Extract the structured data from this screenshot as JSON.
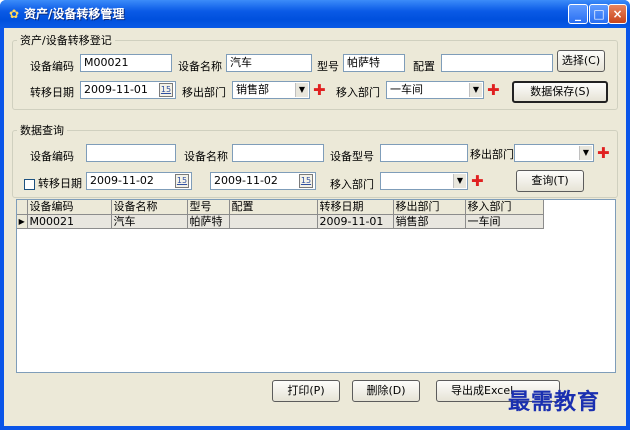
{
  "window": {
    "title": "资产/设备转移管理",
    "icon": "app-gear-icon"
  },
  "registration": {
    "legend": "资产/设备转移登记",
    "code_label": "设备编码",
    "code_value": "M00021",
    "name_label": "设备名称",
    "name_value": "汽车",
    "model_label": "型号",
    "model_value": "帕萨特",
    "config_label": "配置",
    "config_value": "",
    "select_button": "选择(C)",
    "date_label": "转移日期",
    "date_value": "2009-11-01",
    "out_dept_label": "移出部门",
    "out_dept_value": "销售部",
    "in_dept_label": "移入部门",
    "in_dept_value": "一车间",
    "save_button": "数据保存(S)"
  },
  "query": {
    "legend": "数据查询",
    "code_label": "设备编码",
    "code_value": "",
    "name_label": "设备名称",
    "name_value": "",
    "model_label": "设备型号",
    "model_value": "",
    "out_dept_label": "移出部门",
    "out_dept_value": "",
    "date_label": "转移日期",
    "date_checked": false,
    "date_from": "2009-11-02",
    "date_to": "2009-11-02",
    "in_dept_label": "移入部门",
    "in_dept_value": "",
    "query_button": "查询(T)"
  },
  "grid": {
    "columns": [
      "设备编码",
      "设备名称",
      "型号",
      "配置",
      "转移日期",
      "移出部门",
      "移入部门"
    ],
    "rows": [
      [
        "M00021",
        "汽车",
        "帕萨特",
        "",
        "2009-11-01",
        "销售部",
        "一车间"
      ]
    ]
  },
  "footer": {
    "print_button": "打印(P)",
    "delete_button": "删除(D)",
    "export_button": "导出成Excel",
    "watermark": "最需教育"
  },
  "colors": {
    "titlebar": "#0a5ae6",
    "client": "#ece9d8",
    "watermark": "#1a2fb0",
    "add_icon": "#e02020"
  }
}
